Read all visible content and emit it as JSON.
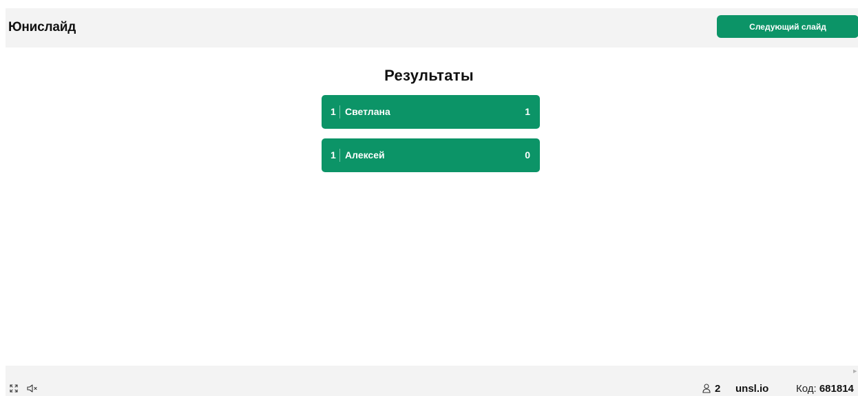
{
  "header": {
    "brand": "Юнислайд",
    "next_button_label": "Следующий слайд"
  },
  "results": {
    "title": "Результаты",
    "rows": [
      {
        "rank": "1",
        "name": "Светлана",
        "score": "1"
      },
      {
        "rank": "1",
        "name": "Алексей",
        "score": "0"
      }
    ]
  },
  "footer": {
    "participants": "2",
    "url": "unsl.io",
    "code_label": "Код:",
    "code_value": "681814",
    "icons": [
      "fullscreen-icon",
      "sound-muted-icon",
      "user-icon"
    ]
  },
  "colors": {
    "accent": "#0c9467",
    "bar_background": "#f3f3f3"
  }
}
